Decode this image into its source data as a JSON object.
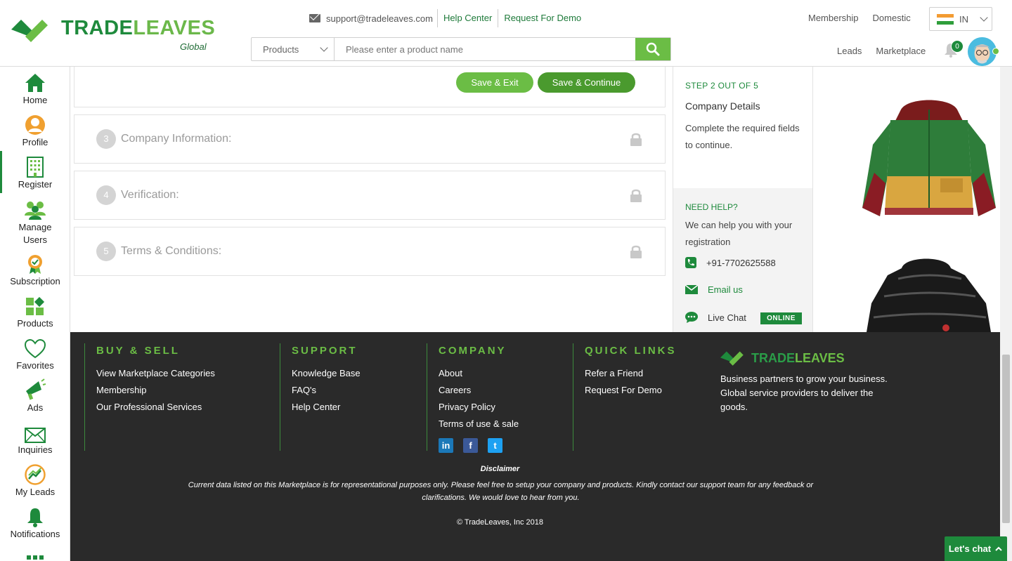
{
  "brand": {
    "name_part1": "TRADE",
    "name_part2": "LEAVES",
    "subtitle": "Global"
  },
  "header": {
    "email": "support@tradeleaves.com",
    "help_center": "Help Center",
    "request_demo": "Request For Demo",
    "membership": "Membership",
    "domestic": "Domestic",
    "leads": "Leads",
    "marketplace": "Marketplace",
    "country_code": "IN",
    "notification_count": "0"
  },
  "search": {
    "category": "Products",
    "placeholder": "Please enter a product name"
  },
  "sidebar": {
    "items": [
      {
        "label": "Home",
        "icon": "home-icon"
      },
      {
        "label": "Profile",
        "icon": "profile-icon"
      },
      {
        "label": "Register",
        "icon": "building-icon"
      },
      {
        "label": "Manage Users",
        "icon": "users-icon"
      },
      {
        "label": "Subscription",
        "icon": "subscription-icon"
      },
      {
        "label": "Products",
        "icon": "products-icon"
      },
      {
        "label": "Favorites",
        "icon": "heart-icon"
      },
      {
        "label": "Ads",
        "icon": "megaphone-icon"
      },
      {
        "label": "Inquiries",
        "icon": "envelope-icon"
      },
      {
        "label": "My Leads",
        "icon": "leads-icon"
      },
      {
        "label": "Notifications",
        "icon": "bell-icon"
      }
    ]
  },
  "form": {
    "save_exit": "Save & Exit",
    "save_continue": "Save & Continue",
    "steps": [
      {
        "num": "3",
        "title": "Company Information:"
      },
      {
        "num": "4",
        "title": "Verification:"
      },
      {
        "num": "5",
        "title": "Terms & Conditions:"
      }
    ]
  },
  "panel": {
    "step_label": "STEP 2 OUT OF 5",
    "title": "Company Details",
    "desc": "Complete the required fields to continue.",
    "help_heading": "NEED HELP?",
    "help_desc": "We can help you with your registration",
    "phone": "+91-7702625588",
    "email_us": "Email us",
    "live_chat": "Live Chat",
    "online": "ONLINE"
  },
  "footer": {
    "buy_sell": {
      "heading": "BUY & SELL",
      "links": [
        "View Marketplace Categories",
        "Membership",
        "Our Professional Services"
      ]
    },
    "support": {
      "heading": "SUPPORT",
      "links": [
        "Knowledge Base",
        "FAQ's",
        "Help Center"
      ]
    },
    "company": {
      "heading": "COMPANY",
      "links": [
        "About",
        "Careers",
        "Privacy Policy",
        "Terms of use & sale"
      ]
    },
    "quick_links": {
      "heading": "QUICK LINKS",
      "links": [
        "Refer a Friend",
        "Request For Demo"
      ]
    },
    "brand_part1": "TRADE",
    "brand_part2": "LEAVES",
    "tagline": "Business partners to grow your business. Global service providers to deliver the goods.",
    "disclaimer_heading": "Disclaimer",
    "disclaimer": "Current data listed on this Marketplace is for representational purposes only. Please feel free to setup your company and products. Kindly contact our support team for any feedback or clarifications. We would love to hear from you.",
    "copyright": "© TradeLeaves, Inc 2018"
  },
  "chat": {
    "label": "Let's chat"
  },
  "colors": {
    "primary": "#1e8a3c",
    "accent": "#6bbd45",
    "footer_bg": "#2a2a2a"
  }
}
